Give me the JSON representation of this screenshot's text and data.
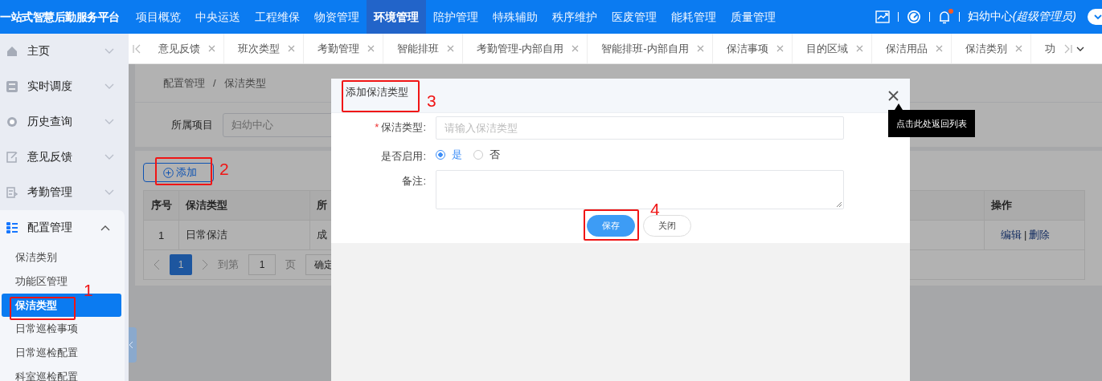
{
  "header": {
    "title": "一站式智慧后勤服务平台",
    "nav": [
      {
        "label": "项目概览",
        "selected": false
      },
      {
        "label": "中央运送",
        "selected": false
      },
      {
        "label": "工程维保",
        "selected": false
      },
      {
        "label": "物资管理",
        "selected": false
      },
      {
        "label": "环境管理",
        "selected": true
      },
      {
        "label": "陪护管理",
        "selected": false
      },
      {
        "label": "特殊辅助",
        "selected": false
      },
      {
        "label": "秩序维护",
        "selected": false
      },
      {
        "label": "医废管理",
        "selected": false
      },
      {
        "label": "能耗管理",
        "selected": false
      },
      {
        "label": "质量管理",
        "selected": false
      }
    ],
    "unread": true,
    "user": "妇幼中心",
    "user_role": "(超级管理员)"
  },
  "sidebar": {
    "items": [
      {
        "label": "主页",
        "expanded": false
      },
      {
        "label": "实时调度",
        "expanded": false
      },
      {
        "label": "历史查询",
        "expanded": false
      },
      {
        "label": "意见反馈",
        "expanded": false
      },
      {
        "label": "考勤管理",
        "expanded": false
      },
      {
        "label": "配置管理",
        "expanded": true,
        "children": [
          {
            "label": "保洁类别",
            "selected": false
          },
          {
            "label": "功能区管理",
            "selected": false
          },
          {
            "label": "保洁类型",
            "selected": true
          },
          {
            "label": "日常巡检事项",
            "selected": false
          },
          {
            "label": "日常巡检配置",
            "selected": false
          },
          {
            "label": "科室巡检配置",
            "selected": false
          }
        ]
      }
    ]
  },
  "tabs": [
    {
      "label": "意见反馈"
    },
    {
      "label": "班次类型"
    },
    {
      "label": "考勤管理"
    },
    {
      "label": "智能排班"
    },
    {
      "label": "考勤管理-内部自用"
    },
    {
      "label": "智能排班-内部自用"
    },
    {
      "label": "保洁事项"
    },
    {
      "label": "目的区域"
    },
    {
      "label": "保洁用品"
    },
    {
      "label": "保洁类别"
    },
    {
      "label": "功"
    }
  ],
  "breadcrumb": {
    "items": [
      "配置管理",
      "保洁类型"
    ],
    "separator": "/"
  },
  "filter": {
    "label": "所属项目",
    "value": "妇幼中心"
  },
  "add_button": "添加",
  "table": {
    "columns": [
      "序号",
      "保洁类型",
      "所",
      "操作"
    ],
    "rows": [
      {
        "cells": [
          "1",
          "日常保洁",
          "成"
        ],
        "actions": [
          "编辑",
          "删除"
        ],
        "action_separator": "|"
      }
    ]
  },
  "pagination": {
    "pages": [
      {
        "label": "1",
        "selected": true
      }
    ],
    "goto_label": "到第",
    "goto_value": "1",
    "page_label": "页",
    "confirm": "确定"
  },
  "modal": {
    "title": "添加保洁类型",
    "fields": [
      {
        "kind": "text",
        "label": "保洁类型:",
        "required_mark": "*",
        "placeholder": "请输入保洁类型"
      },
      {
        "kind": "radio",
        "label": "是否启用:",
        "options": [
          {
            "label": "是",
            "selected": true
          },
          {
            "label": "否",
            "selected": false
          }
        ]
      },
      {
        "kind": "textarea",
        "label": "备注:"
      }
    ],
    "buttons": [
      {
        "label": "保存",
        "primary": true
      },
      {
        "label": "关闭",
        "primary": false
      }
    ]
  },
  "tooltip": "点击此处返回列表",
  "annotations": [
    {
      "label": "1"
    },
    {
      "label": "2"
    },
    {
      "label": "3"
    },
    {
      "label": "4"
    }
  ]
}
